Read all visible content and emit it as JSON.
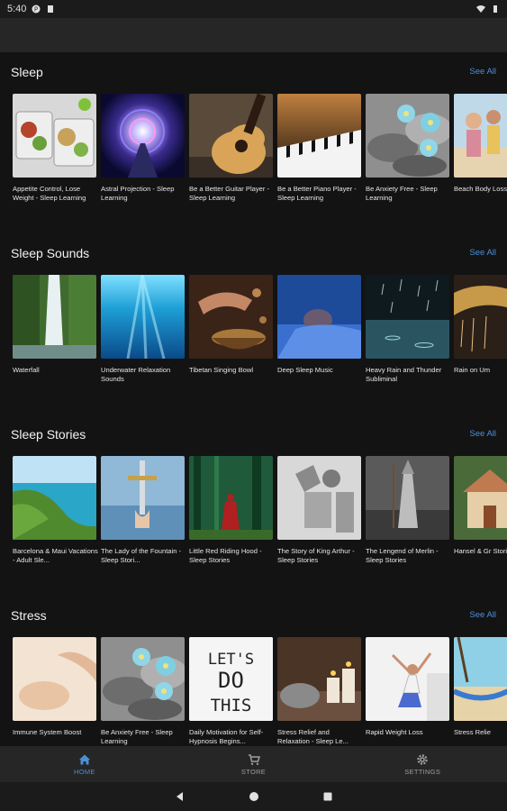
{
  "status_bar": {
    "time": "5:40"
  },
  "see_all_label": "See All",
  "sections": [
    {
      "title": "Sleep",
      "items": [
        "Appetite Control, Lose Weight - Sleep Learning",
        "Astral Projection - Sleep Learning",
        "Be a Better Guitar Player - Sleep Learning",
        "Be a Better Piano Player - Sleep Learning",
        "Be Anxiety Free - Sleep Learning",
        "Beach Body Loss - Sleep"
      ]
    },
    {
      "title": "Sleep Sounds",
      "items": [
        "Waterfall",
        "Underwater Relaxation Sounds",
        "Tibetan Singing Bowl",
        "Deep Sleep Music",
        "Heavy Rain and Thunder Subliminal",
        "Rain on Um"
      ]
    },
    {
      "title": "Sleep Stories",
      "items": [
        "Barcelona & Maui Vacations - Adult Sle...",
        "The Lady of the Fountain - Sleep Stori...",
        "Little Red Riding Hood - Sleep Stories",
        "The Story of King Arthur - Sleep Stories",
        "The Lengend of Merlin - Sleep Stories",
        "Hansel & Gr Stories"
      ]
    },
    {
      "title": "Stress",
      "items": [
        "Immune System Boost",
        "Be Anxiety Free - Sleep Learning",
        "Daily Motivation for Self-Hypnosis Begins...",
        "Stress Relief and Relaxation - Sleep Le...",
        "Rapid Weight Loss",
        "Stress Relie"
      ]
    }
  ],
  "motivation_art_text": [
    "LET'S",
    "DO",
    "THIS"
  ],
  "bottom_nav": [
    {
      "label": "HOME",
      "icon": "home-icon",
      "active": true
    },
    {
      "label": "STORE",
      "icon": "cart-icon",
      "active": false
    },
    {
      "label": "SETTINGS",
      "icon": "gear-icon",
      "active": false
    }
  ],
  "colors": {
    "accent": "#4a90d9",
    "background": "#131313",
    "bar": "#262626"
  }
}
